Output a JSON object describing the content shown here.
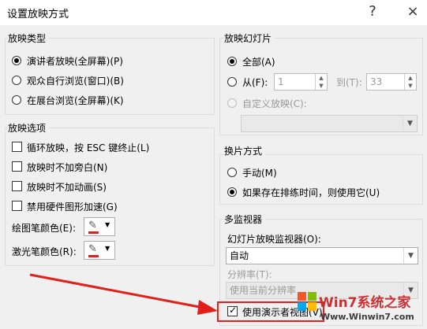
{
  "dialog": {
    "title": "设置放映方式",
    "help": "?",
    "close": "×"
  },
  "show_type": {
    "header": "放映类型",
    "options": [
      "演讲者放映(全屏幕)(P)",
      "观众自行浏览(窗口)(B)",
      "在展台浏览(全屏幕)(K)"
    ],
    "selected": 0
  },
  "show_options": {
    "header": "放映选项",
    "checks": [
      "循环放映，按 ESC 键终止(L)",
      "放映时不加旁白(N)",
      "放映时不加动画(S)",
      "禁用硬件图形加速(G)"
    ],
    "pen_color_label": "绘图笔颜色(E):",
    "laser_color_label": "激光笔颜色(R):",
    "pen_color": "#e02020"
  },
  "slides": {
    "header": "放映幻灯片",
    "all_label": "全部(A)",
    "from_label": "从(F):",
    "from_value": "1",
    "to_label": "到(T):",
    "to_value": "33",
    "custom_label": "自定义放映(C):"
  },
  "advance": {
    "header": "换片方式",
    "options": [
      "手动(M)",
      "如果存在排练时间，则使用它(U)"
    ],
    "selected": 1
  },
  "monitors": {
    "header": "多监视器",
    "monitor_label": "幻灯片放映监视器(O):",
    "monitor_value": "自动",
    "resolution_label": "分辨率(T):",
    "resolution_value": "使用当前分辨率",
    "presenter_view_label": "使用演示者视图(V)",
    "presenter_view_checked": true
  },
  "watermark": {
    "brand": "Win7系统之家",
    "url": "Www.Winwin7.com"
  },
  "colors": {
    "accent": "#e02020",
    "arrow": "#e0201a"
  }
}
